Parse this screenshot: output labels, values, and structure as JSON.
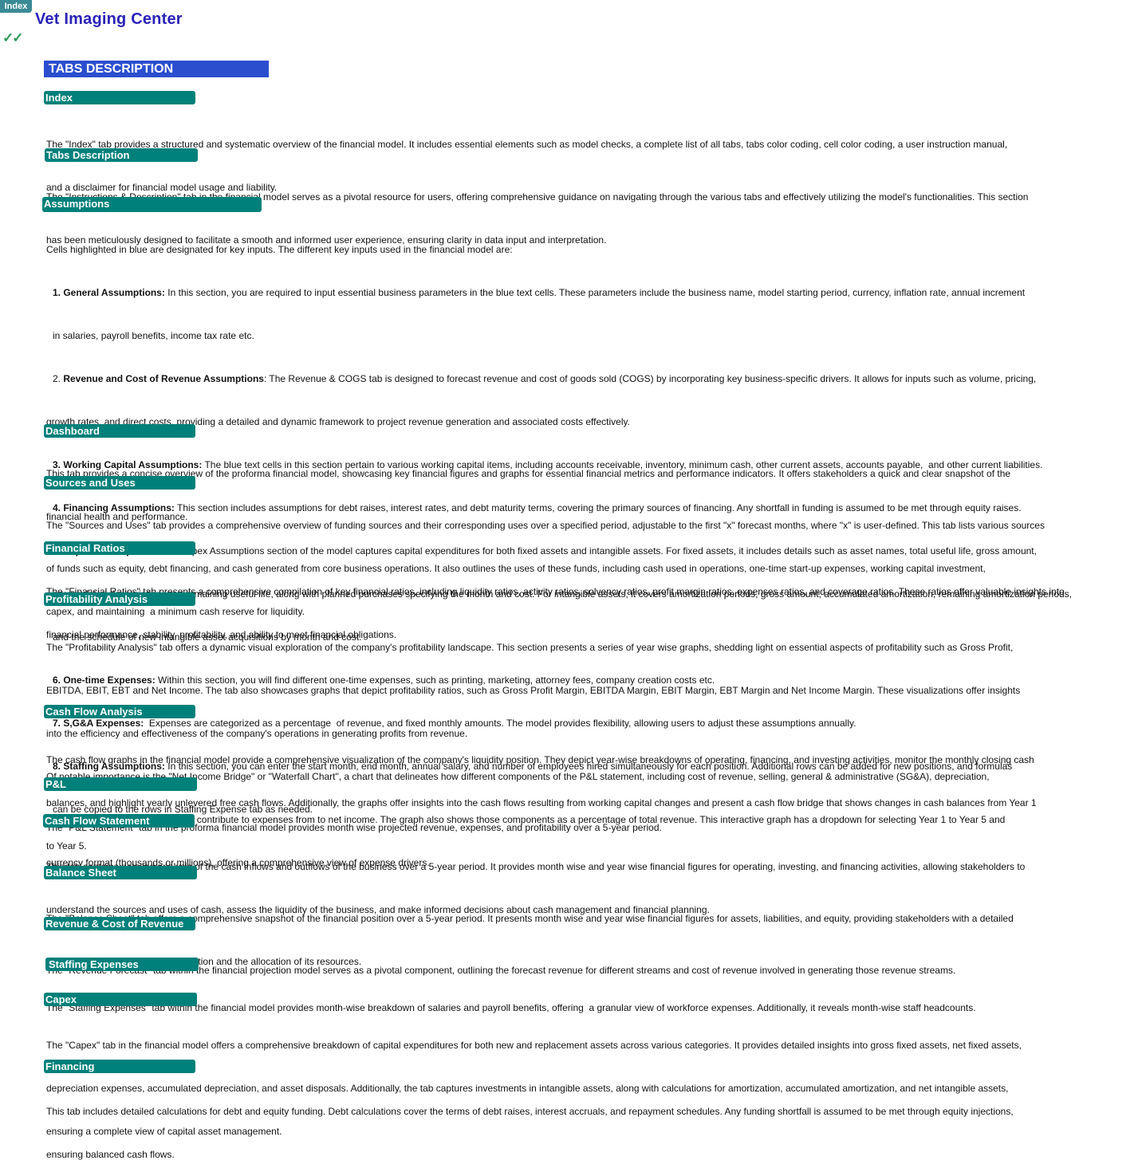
{
  "nav": {
    "index_button": "Index"
  },
  "header": {
    "title": "Vet Imaging Center",
    "check_icon": "✓✓",
    "section_title": "TABS DESCRIPTION"
  },
  "colors": {
    "title": "#2a22b8",
    "section_title_bg": "#2b4ecf",
    "tab_header_bg": "#00807a",
    "index_button_bg": "#3a8a96",
    "checks": "#2e9a5a"
  },
  "sections": [
    {
      "title": "Index",
      "lines": [
        "The \"Index\" tab provides a structured and systematic overview of the financial model. It includes essential elements such as model checks, a complete list of all tabs, tabs color coding, cell color coding, a user instruction manual,",
        "and a disclaimer for financial model usage and liability."
      ]
    },
    {
      "title": "Tabs Description",
      "lines": [
        "The \"Instructions & Description\" tab in the financial model serves as a pivotal resource for users, offering comprehensive guidance on navigating through the various tabs and effectively utilizing the model's functionalities. This section",
        "has been meticulously designed to facilitate a smooth and informed user experience, ensuring clarity in data input and interpretation."
      ]
    },
    {
      "title": "Assumptions",
      "intro": "Cells highlighted in blue are designated for key inputs. The different key inputs used in the financial model are:",
      "items": [
        {
          "label": "1. General Assumptions:",
          "lines": [
            " In this section, you are required to input essential business parameters in the blue text cells. These parameters include the business name, model starting period, currency, inflation rate, annual increment",
            "in salaries, payroll benefits, income tax rate etc."
          ]
        },
        {
          "num": "2. ",
          "label": "Revenue and Cost of Revenue Assumptions",
          "lines": [
            ": The Revenue & COGS tab is designed to forecast revenue and cost of goods sold (COGS) by incorporating key business-specific drivers. It allows for inputs such as volume, pricing,",
            "growth rates, and direct costs, providing a detailed and dynamic framework to project revenue generation and associated costs effectively."
          ]
        },
        {
          "label": "3. Working Capital Assumptions:",
          "lines": [
            " The blue text cells in this section pertain to various working capital items, including accounts receivable, inventory, minimum cash, other current assets, accounts payable,  and other current liabilities."
          ]
        },
        {
          "label": "4. Financing Assumptions:",
          "lines": [
            " This section includes assumptions for debt raises, interest rates, and debt maturity terms, covering the primary sources of financing. Any shortfall in funding is assumed to be met through equity raises."
          ]
        },
        {
          "label": "5. Capex Assumptions:",
          "lines": [
            " The Capex Assumptions section of the model captures capital expenditures for both fixed assets and intangible assets. For fixed assets, it includes details such as asset names, total useful life, gross amount,",
            "accumulated depreciation, and remaining useful life, along with planned purchases specifying the month and cost. For intangible assets, it covers amortization periods, gross amount, accumulated amortization, remaining amortization periods,",
            "and the schedule of new intangible asset acquisitions by month and cost."
          ]
        },
        {
          "label": "6. One-time Expenses:",
          "lines": [
            " Within this section, you will find different one-time expenses, such as printing, marketing, attorney fees, company creation costs etc."
          ]
        },
        {
          "label": "7. S,G&A Expenses:",
          "lines": [
            "  Expenses are categorized as a percentage  of revenue, and fixed monthly amounts. The model provides flexibility, allowing users to adjust these assumptions annually."
          ]
        },
        {
          "label": "8. Staffing Assumptions:",
          "lines": [
            " In this section, you can enter the start month, end month, annual salary, and number of employees hired simultaneously for each position. Additional rows can be added for new positions, and formulas",
            "can be copied to the rows in Staffing Expense tab as needed."
          ]
        }
      ]
    },
    {
      "title": "Dashboard",
      "lines": [
        "This tab provides a concise overview of the proforma financial model, showcasing key financial figures and graphs for essential financial metrics and performance indicators. It offers stakeholders a quick and clear snapshot of the",
        "financial health and performance."
      ]
    },
    {
      "title": "Sources and Uses",
      "lines": [
        "The \"Sources and Uses\" tab provides a comprehensive overview of funding sources and their corresponding uses over a specified period, adjustable to the first \"x\" forecast months, where \"x\" is user-defined. This tab lists various sources",
        "of funds such as equity, debt financing, and cash generated from core business operations. It also outlines the uses of these funds, including cash used in operations, one-time start-up expenses, working capital investment,",
        "capex, and maintaining  a minimum cash reserve for liquidity."
      ]
    },
    {
      "title": "Financial Ratios",
      "lines": [
        "The \"Financial Ratios\" tab presents a comprehensive compilation of key financial ratios, including liquidity ratios, activity ratios, solvency ratios, profit margin ratios, expenses ratios, and coverage ratios. These ratios offer valuable insights into",
        "financial performance, stability, profitability, and ability to meet financial obligations."
      ]
    },
    {
      "title": "Profitability Analysis",
      "lines": [
        "The \"Profitability Analysis\" tab offers a dynamic visual exploration of the company's profitability landscape. This section presents a series of year wise graphs, shedding light on essential aspects of profitability such as Gross Profit,",
        "EBITDA, EBIT, EBT and Net Income. The tab also showcases graphs that depict profitability ratios, such as Gross Profit Margin, EBITDA Margin, EBIT Margin, EBT Margin and Net Income Margin. These visualizations offer insights",
        "into the efficiency and effectiveness of the company's operations in generating profits from revenue.",
        "Of notable importance is the \"Net Income Bridge\" or \"Waterfall Chart\", a chart that delineates how different components of the P&L statement, including cost of revenue, selling, general & administrative (SG&A), depreciation,",
        "interest expenses, and income tax, contribute to expenses from to net income. The graph also shows those components as a percentage of total revenue. This interactive graph has a dropdown for selecting Year 1 to Year 5 and",
        "currency format (thousands or millions), offering a comprehensive view of expense drivers."
      ]
    },
    {
      "title": "Cash Flow Analysis",
      "lines": [
        "The cash flow graphs in the financial model provide a comprehensive visualization of the company's liquidity position. They depict year-wise breakdowns of operating, financing, and investing activities, monitor the monthly closing cash",
        "balances, and highlight yearly unlevered free cash flows. Additionally, the graphs offer insights into the cash flows resulting from working capital changes and present a cash flow bridge that shows changes in cash balances from Year 1",
        "to Year 5."
      ]
    },
    {
      "title": "P&L",
      "lines": [
        "The \"P&L Statement\" tab in the proforma financial model provides month wise projected revenue, expenses, and profitability over a 5-year period."
      ]
    },
    {
      "title": "Cash Flow Statement",
      "lines": [
        "This tab contains detailed analysis of the cash inflows and outflows of the business over a 5-year period. It provides month wise and year wise financial figures for operating, investing, and financing activities, allowing stakeholders to",
        "understand the sources and uses of cash, assess the liquidity of the business, and make informed decisions about cash management and financial planning."
      ]
    },
    {
      "title": "Balance Sheet",
      "lines": [
        "The \"Balance Sheet\" tab offers a comprehensive snapshot of the financial position over a 5-year period. It presents month wise and year wise financial figures for assets, liabilities, and equity, providing stakeholders with a detailed",
        "view of the company's financial position and the allocation of its resources."
      ]
    },
    {
      "title": "Revenue & Cost of Revenue",
      "lines": [
        "The \"Revenue Forecast\" tab within the financial projection model serves as a pivotal component, outlining the forecast revenue for different streams and cost of revenue involved in generating those revenue streams."
      ]
    },
    {
      "title": "Staffing Expenses",
      "lines": [
        "The \"Staffing Expenses\" tab within the financial model provides month-wise breakdown of salaries and payroll benefits, offering  a granular view of workforce expenses. Additionally, it reveals month-wise staff headcounts."
      ]
    },
    {
      "title": "Capex",
      "lines": [
        "The \"Capex\" tab in the financial model offers a comprehensive breakdown of capital expenditures for both new and replacement assets across various categories. It provides detailed insights into gross fixed assets, net fixed assets,",
        "depreciation expenses, accumulated depreciation, and asset disposals. Additionally, the tab captures investments in intangible assets, along with calculations for amortization, accumulated amortization, and net intangible assets,",
        "ensuring a complete view of capital asset management."
      ]
    },
    {
      "title": "Financing",
      "lines": [
        "This tab includes detailed calculations for debt and equity funding. Debt calculations cover the terms of debt raises, interest accruals, and repayment schedules. Any funding shortfall is assumed to be met through equity injections,",
        "ensuring balanced cash flows."
      ]
    }
  ]
}
